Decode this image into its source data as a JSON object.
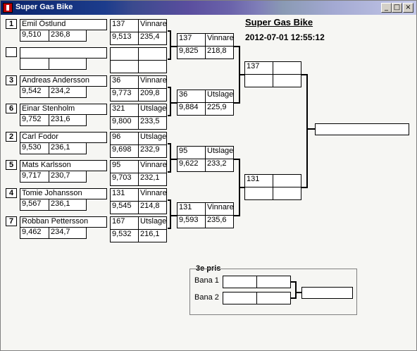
{
  "window": {
    "title": "Super Gas Bike",
    "icon": "app-icon",
    "buttons": [
      "_",
      "□",
      "×"
    ]
  },
  "header": {
    "title": "Super Gas Bike",
    "datetime": "2012-07-01 12:55:12"
  },
  "round1": [
    {
      "seed": "1",
      "name": "Emil Östlund",
      "rt": "9,510",
      "speed": "236,8"
    },
    {
      "seed": "",
      "name": "",
      "rt": "",
      "speed": ""
    },
    {
      "seed": "3",
      "name": "Andreas Andersson",
      "rt": "9,542",
      "speed": "234,2"
    },
    {
      "seed": "6",
      "name": "Einar Stenholm",
      "rt": "9,752",
      "speed": "231,6"
    },
    {
      "seed": "2",
      "name": "Carl Fodor",
      "rt": "9,530",
      "speed": "236,1"
    },
    {
      "seed": "5",
      "name": "Mats Karlsson",
      "rt": "9,717",
      "speed": "230,7"
    },
    {
      "seed": "4",
      "name": "Tomie Johansson",
      "rt": "9,567",
      "speed": "236,1"
    },
    {
      "seed": "7",
      "name": "Robban Pettersson",
      "rt": "9,462",
      "speed": "234,7"
    }
  ],
  "round1_result": [
    {
      "num": "137",
      "status": "Vinnare",
      "et": "9,513",
      "speed": "235,4"
    },
    {
      "num": "",
      "status": "",
      "et": "",
      "speed": ""
    },
    {
      "num": "36",
      "status": "Vinnare",
      "et": "9,773",
      "speed": "209,8"
    },
    {
      "num": "321",
      "status": "Utslagen",
      "et": "9,800",
      "speed": "233,5"
    },
    {
      "num": "96",
      "status": "Utslagen",
      "et": "9,698",
      "speed": "232,9"
    },
    {
      "num": "95",
      "status": "Vinnare",
      "et": "9,703",
      "speed": "232,1"
    },
    {
      "num": "131",
      "status": "Vinnare",
      "et": "9,545",
      "speed": "214,8"
    },
    {
      "num": "167",
      "status": "Utslagen",
      "et": "9,532",
      "speed": "216,1"
    }
  ],
  "round2": [
    {
      "num": "137",
      "status": "Vinnare",
      "et": "9,825",
      "speed": "218,8"
    },
    {
      "num": "36",
      "status": "Utslagen",
      "et": "9,884",
      "speed": "225,9"
    },
    {
      "num": "95",
      "status": "Utslagen",
      "et": "9,622",
      "speed": "233,2"
    },
    {
      "num": "131",
      "status": "Vinnare",
      "et": "9,593",
      "speed": "235,6"
    }
  ],
  "semis": [
    {
      "num": "137",
      "status": "",
      "et": "",
      "speed": ""
    },
    {
      "num": "131",
      "status": "",
      "et": "",
      "speed": ""
    }
  ],
  "final": {
    "winner": ""
  },
  "third_place": {
    "label": "3e pris",
    "lanes": [
      {
        "label": "Bana 1",
        "a": "",
        "b": ""
      },
      {
        "label": "Bana 2",
        "a": "",
        "b": ""
      }
    ],
    "winner": ""
  }
}
